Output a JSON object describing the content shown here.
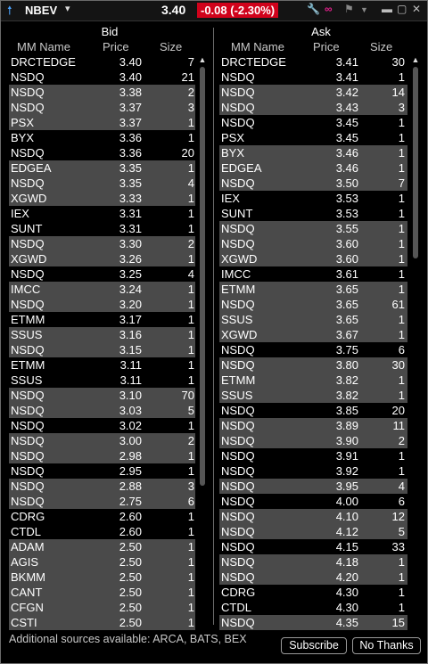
{
  "titlebar": {
    "arrow_icon": "up-arrow-icon",
    "symbol": "NBEV",
    "caret": "▾",
    "last": "3.40",
    "change": "-0.08  (-2.30%)",
    "change_color": "#d0021b"
  },
  "bid": {
    "title": "Bid",
    "col_mm": "MM Name",
    "col_price": "Price",
    "col_size": "Size",
    "rows": [
      {
        "mm": "DRCTEDGE",
        "price": "3.40",
        "size": "7",
        "hl": false
      },
      {
        "mm": "NSDQ",
        "price": "3.40",
        "size": "21",
        "hl": false
      },
      {
        "mm": "NSDQ",
        "price": "3.38",
        "size": "2",
        "hl": true
      },
      {
        "mm": "NSDQ",
        "price": "3.37",
        "size": "3",
        "hl": true
      },
      {
        "mm": "PSX",
        "price": "3.37",
        "size": "1",
        "hl": true
      },
      {
        "mm": "BYX",
        "price": "3.36",
        "size": "1",
        "hl": false
      },
      {
        "mm": "NSDQ",
        "price": "3.36",
        "size": "20",
        "hl": false
      },
      {
        "mm": "EDGEA",
        "price": "3.35",
        "size": "1",
        "hl": true
      },
      {
        "mm": "NSDQ",
        "price": "3.35",
        "size": "4",
        "hl": true
      },
      {
        "mm": "XGWD",
        "price": "3.33",
        "size": "1",
        "hl": true
      },
      {
        "mm": "IEX",
        "price": "3.31",
        "size": "1",
        "hl": false
      },
      {
        "mm": "SUNT",
        "price": "3.31",
        "size": "1",
        "hl": false
      },
      {
        "mm": "NSDQ",
        "price": "3.30",
        "size": "2",
        "hl": true
      },
      {
        "mm": "XGWD",
        "price": "3.26",
        "size": "1",
        "hl": true
      },
      {
        "mm": "NSDQ",
        "price": "3.25",
        "size": "4",
        "hl": false
      },
      {
        "mm": "IMCC",
        "price": "3.24",
        "size": "1",
        "hl": true
      },
      {
        "mm": "NSDQ",
        "price": "3.20",
        "size": "1",
        "hl": true
      },
      {
        "mm": "ETMM",
        "price": "3.17",
        "size": "1",
        "hl": false
      },
      {
        "mm": "SSUS",
        "price": "3.16",
        "size": "1",
        "hl": true
      },
      {
        "mm": "NSDQ",
        "price": "3.15",
        "size": "1",
        "hl": true
      },
      {
        "mm": "ETMM",
        "price": "3.11",
        "size": "1",
        "hl": false
      },
      {
        "mm": "SSUS",
        "price": "3.11",
        "size": "1",
        "hl": false
      },
      {
        "mm": "NSDQ",
        "price": "3.10",
        "size": "70",
        "hl": true
      },
      {
        "mm": "NSDQ",
        "price": "3.03",
        "size": "5",
        "hl": true
      },
      {
        "mm": "NSDQ",
        "price": "3.02",
        "size": "1",
        "hl": false
      },
      {
        "mm": "NSDQ",
        "price": "3.00",
        "size": "2",
        "hl": true
      },
      {
        "mm": "NSDQ",
        "price": "2.98",
        "size": "1",
        "hl": true
      },
      {
        "mm": "NSDQ",
        "price": "2.95",
        "size": "1",
        "hl": false
      },
      {
        "mm": "NSDQ",
        "price": "2.88",
        "size": "3",
        "hl": true
      },
      {
        "mm": "NSDQ",
        "price": "2.75",
        "size": "6",
        "hl": true
      },
      {
        "mm": "CDRG",
        "price": "2.60",
        "size": "1",
        "hl": false
      },
      {
        "mm": "CTDL",
        "price": "2.60",
        "size": "1",
        "hl": false
      },
      {
        "mm": "ADAM",
        "price": "2.50",
        "size": "1",
        "hl": true
      },
      {
        "mm": "AGIS",
        "price": "2.50",
        "size": "1",
        "hl": true
      },
      {
        "mm": "BKMM",
        "price": "2.50",
        "size": "1",
        "hl": true
      },
      {
        "mm": "CANT",
        "price": "2.50",
        "size": "1",
        "hl": true
      },
      {
        "mm": "CFGN",
        "price": "2.50",
        "size": "1",
        "hl": true
      },
      {
        "mm": "CSTI",
        "price": "2.50",
        "size": "1",
        "hl": true
      }
    ]
  },
  "ask": {
    "title": "Ask",
    "col_mm": "MM Name",
    "col_price": "Price",
    "col_size": "Size",
    "rows": [
      {
        "mm": "DRCTEDGE",
        "price": "3.41",
        "size": "30",
        "hl": false
      },
      {
        "mm": "NSDQ",
        "price": "3.41",
        "size": "1",
        "hl": false
      },
      {
        "mm": "NSDQ",
        "price": "3.42",
        "size": "14",
        "hl": true
      },
      {
        "mm": "NSDQ",
        "price": "3.43",
        "size": "3",
        "hl": true
      },
      {
        "mm": "NSDQ",
        "price": "3.45",
        "size": "1",
        "hl": false
      },
      {
        "mm": "PSX",
        "price": "3.45",
        "size": "1",
        "hl": false
      },
      {
        "mm": "BYX",
        "price": "3.46",
        "size": "1",
        "hl": true
      },
      {
        "mm": "EDGEA",
        "price": "3.46",
        "size": "1",
        "hl": true
      },
      {
        "mm": "NSDQ",
        "price": "3.50",
        "size": "7",
        "hl": true
      },
      {
        "mm": "IEX",
        "price": "3.53",
        "size": "1",
        "hl": false
      },
      {
        "mm": "SUNT",
        "price": "3.53",
        "size": "1",
        "hl": false
      },
      {
        "mm": "NSDQ",
        "price": "3.55",
        "size": "1",
        "hl": true
      },
      {
        "mm": "NSDQ",
        "price": "3.60",
        "size": "1",
        "hl": true
      },
      {
        "mm": "XGWD",
        "price": "3.60",
        "size": "1",
        "hl": true
      },
      {
        "mm": "IMCC",
        "price": "3.61",
        "size": "1",
        "hl": false
      },
      {
        "mm": "ETMM",
        "price": "3.65",
        "size": "1",
        "hl": true
      },
      {
        "mm": "NSDQ",
        "price": "3.65",
        "size": "61",
        "hl": true
      },
      {
        "mm": "SSUS",
        "price": "3.65",
        "size": "1",
        "hl": true
      },
      {
        "mm": "XGWD",
        "price": "3.67",
        "size": "1",
        "hl": true
      },
      {
        "mm": "NSDQ",
        "price": "3.75",
        "size": "6",
        "hl": false
      },
      {
        "mm": "NSDQ",
        "price": "3.80",
        "size": "30",
        "hl": true
      },
      {
        "mm": "ETMM",
        "price": "3.82",
        "size": "1",
        "hl": true
      },
      {
        "mm": "SSUS",
        "price": "3.82",
        "size": "1",
        "hl": true
      },
      {
        "mm": "NSDQ",
        "price": "3.85",
        "size": "20",
        "hl": false
      },
      {
        "mm": "NSDQ",
        "price": "3.89",
        "size": "11",
        "hl": true
      },
      {
        "mm": "NSDQ",
        "price": "3.90",
        "size": "2",
        "hl": true
      },
      {
        "mm": "NSDQ",
        "price": "3.91",
        "size": "1",
        "hl": false
      },
      {
        "mm": "NSDQ",
        "price": "3.92",
        "size": "1",
        "hl": false
      },
      {
        "mm": "NSDQ",
        "price": "3.95",
        "size": "4",
        "hl": true
      },
      {
        "mm": "NSDQ",
        "price": "4.00",
        "size": "6",
        "hl": false
      },
      {
        "mm": "NSDQ",
        "price": "4.10",
        "size": "12",
        "hl": true
      },
      {
        "mm": "NSDQ",
        "price": "4.12",
        "size": "5",
        "hl": true
      },
      {
        "mm": "NSDQ",
        "price": "4.15",
        "size": "33",
        "hl": false
      },
      {
        "mm": "NSDQ",
        "price": "4.18",
        "size": "1",
        "hl": true
      },
      {
        "mm": "NSDQ",
        "price": "4.20",
        "size": "1",
        "hl": true
      },
      {
        "mm": "CDRG",
        "price": "4.30",
        "size": "1",
        "hl": false
      },
      {
        "mm": "CTDL",
        "price": "4.30",
        "size": "1",
        "hl": false
      },
      {
        "mm": "NSDQ",
        "price": "4.35",
        "size": "15",
        "hl": true
      }
    ]
  },
  "footer": {
    "notice": "Additional sources available: ARCA, BATS, BEX",
    "subscribe_label": "Subscribe",
    "no_thanks_label": "No Thanks"
  }
}
